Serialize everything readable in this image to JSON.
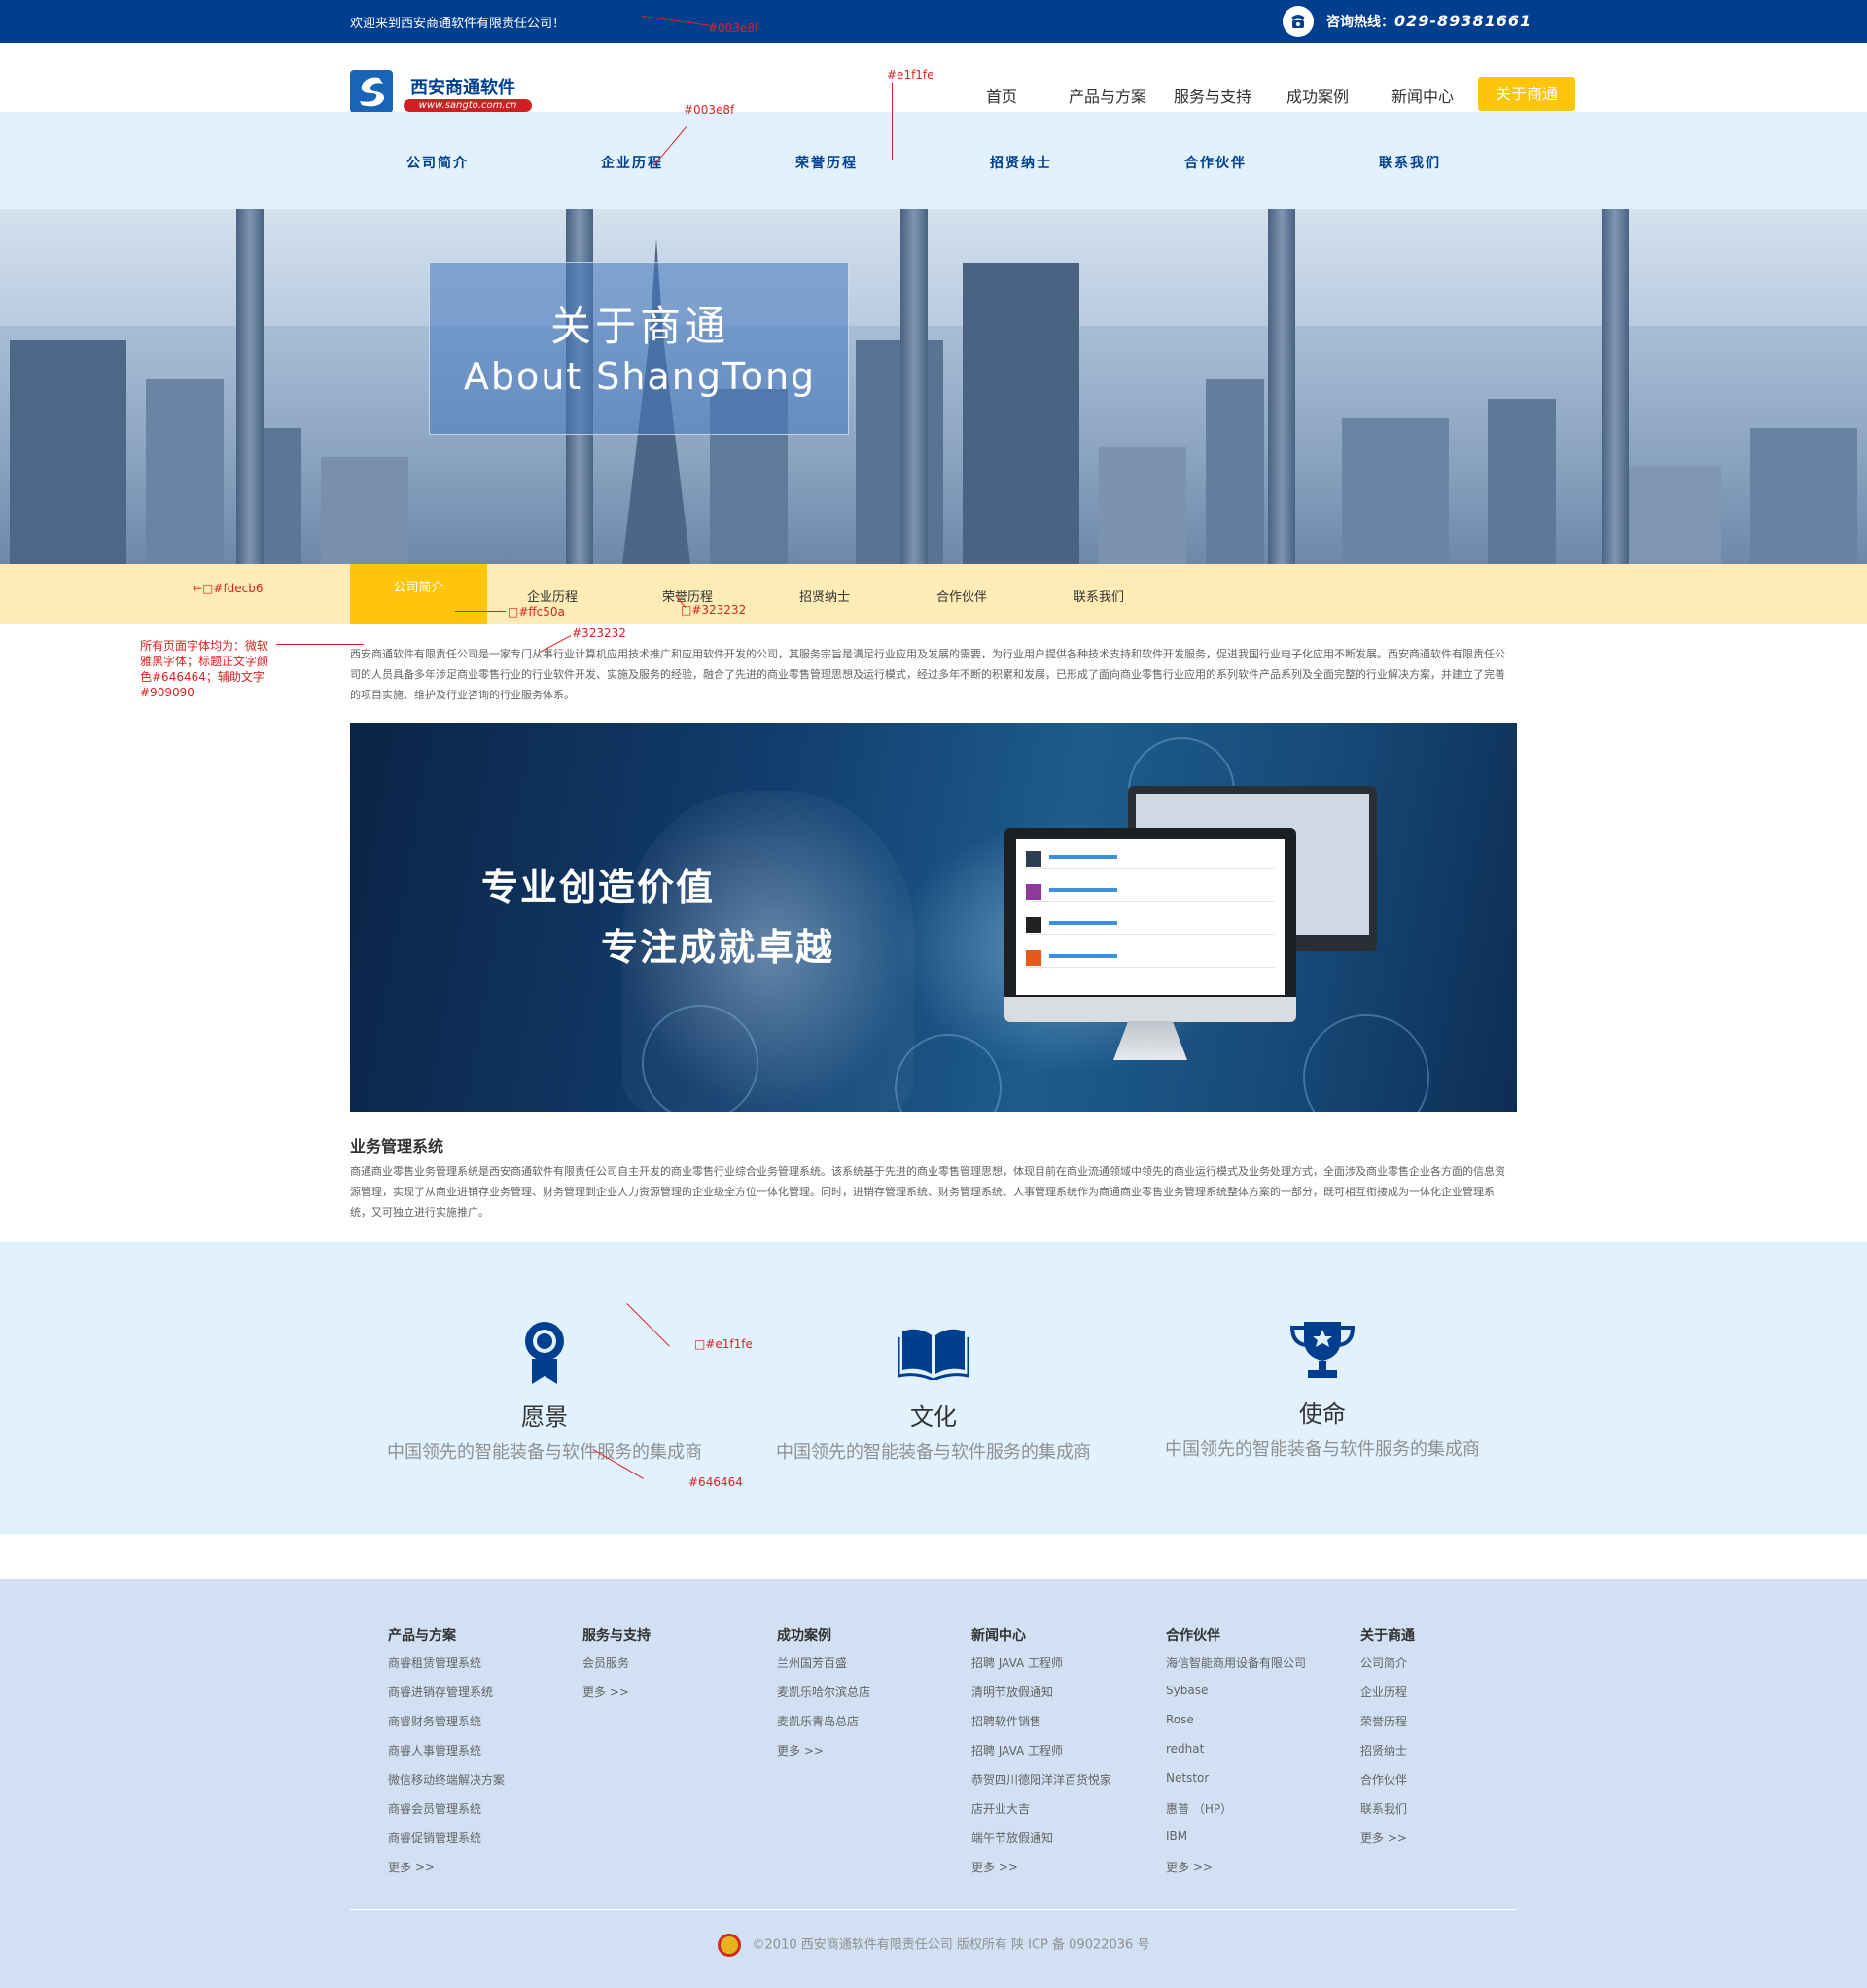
{
  "topbar": {
    "welcome": "欢迎来到西安商通软件有限责任公司！",
    "hotline_label": "咨询热线：",
    "hotline_number": "029-89381661"
  },
  "logo": {
    "name": "西安商通软件",
    "url": "www.sangto.com.cn"
  },
  "main_nav": {
    "items": [
      "首页",
      "产品与方案",
      "服务与支持",
      "成功案例",
      "新闻中心"
    ],
    "active": "关于商通"
  },
  "sub_nav": {
    "items": [
      "公司简介",
      "企业历程",
      "荣誉历程",
      "招贤纳士",
      "合作伙伴",
      "联系我们"
    ]
  },
  "hero": {
    "title_cn": "关于商通",
    "title_en": "About ShangTong"
  },
  "tabs": {
    "active": "公司简介",
    "items": [
      "企业历程",
      "荣誉历程",
      "招贤纳士",
      "合作伙伴",
      "联系我们"
    ]
  },
  "intro": {
    "text": "西安商通软件有限责任公司是一家专门从事行业计算机应用技术推广和应用软件开发的公司，其服务宗旨是满足行业应用及发展的需要，为行业用户提供各种技术支持和软件开发服务，促进我国行业电子化应用不断发展。西安商通软件有限责任公司的人员具备多年涉足商业零售行业的行业软件开发、实施及服务的经验，融合了先进的商业零售管理思想及运行模式，经过多年不断的积累和发展，已形成了面向商业零售行业应用的系列软件产品系列及全面完整的行业解决方案，并建立了完善的项目实施、维护及行业咨询的行业服务体系。"
  },
  "banner": {
    "line1": "专业创造价值",
    "line2": "专注成就卓越"
  },
  "system": {
    "title": "业务管理系统",
    "text": "商通商业零售业务管理系统是西安商通软件有限责任公司自主开发的商业零售行业综合业务管理系统。该系统基于先进的商业零售管理思想，体现目前在商业流通领域中领先的商业运行模式及业务处理方式，全面涉及商业零售企业各方面的信息资源管理，实现了从商业进销存业务管理、财务管理到企业人力资源管理的企业级全方位一体化管理。同时，进销存管理系统、财务管理系统、人事管理系统作为商通商业零售业务管理系统整体方案的一部分，既可相互衔接成为一体化企业管理系统，又可独立进行实施推广。"
  },
  "vision": [
    {
      "icon": "badge-icon",
      "title": "愿景",
      "desc": "中国领先的智能装备与软件服务的集成商"
    },
    {
      "icon": "book-icon",
      "title": "文化",
      "desc": "中国领先的智能装备与软件服务的集成商"
    },
    {
      "icon": "trophy-icon",
      "title": "使命",
      "desc": "中国领先的智能装备与软件服务的集成商"
    }
  ],
  "footer": {
    "columns": [
      {
        "title": "产品与方案",
        "links": [
          "商睿租赁管理系统",
          "商睿进销存管理系统",
          "商睿财务管理系统",
          "商睿人事管理系统",
          "微信移动终端解决方案",
          "商睿会员管理系统",
          "商睿促销管理系统",
          "更多 >>"
        ]
      },
      {
        "title": "服务与支持",
        "links": [
          "会员服务",
          "更多 >>"
        ]
      },
      {
        "title": "成功案例",
        "links": [
          "兰州国芳百盛",
          "麦凯乐哈尔滨总店",
          "麦凯乐青岛总店",
          "更多 >>"
        ]
      },
      {
        "title": "新闻中心",
        "links": [
          "招聘 JAVA 工程师",
          "清明节放假通知",
          "招聘软件销售",
          "招聘 JAVA 工程师",
          "恭贺四川德阳洋洋百货悦家",
          "店开业大吉",
          "端午节放假通知",
          "更多 >>"
        ]
      },
      {
        "title": "合作伙伴",
        "links": [
          "海信智能商用设备有限公司",
          "Sybase",
          "Rose",
          "redhat",
          "Netstor",
          "惠普 （HP）",
          "IBM",
          "更多 >>"
        ]
      },
      {
        "title": "关于商通",
        "links": [
          "公司简介",
          "企业历程",
          "荣誉历程",
          "招贤纳士",
          "合作伙伴",
          "联系我们",
          "更多 >>"
        ]
      }
    ],
    "copyright": "©2010 西安商通软件有限责任公司 版权所有   陕 ICP 备 09022036 号"
  },
  "annotations": {
    "a1": "#003e8f",
    "a2": "#e1f1fe",
    "a3": "#003e8f",
    "a4": "←□#fdecb6",
    "a5": "□#ffc50a",
    "a6": "□#323232",
    "a7": "#323232",
    "a8": "所有页面字体均为：微软雅黑字体；标题正文字颜色#646464；辅助文字#909090",
    "a9": "□#e1f1fe",
    "a10": "#646464"
  },
  "colors": {
    "primary": "#003e8f",
    "accent": "#ffc50a",
    "tab_bg": "#fdecb6",
    "light_bg": "#e1f1fe",
    "text": "#323232",
    "body_text": "#646464",
    "aux_text": "#909090"
  }
}
